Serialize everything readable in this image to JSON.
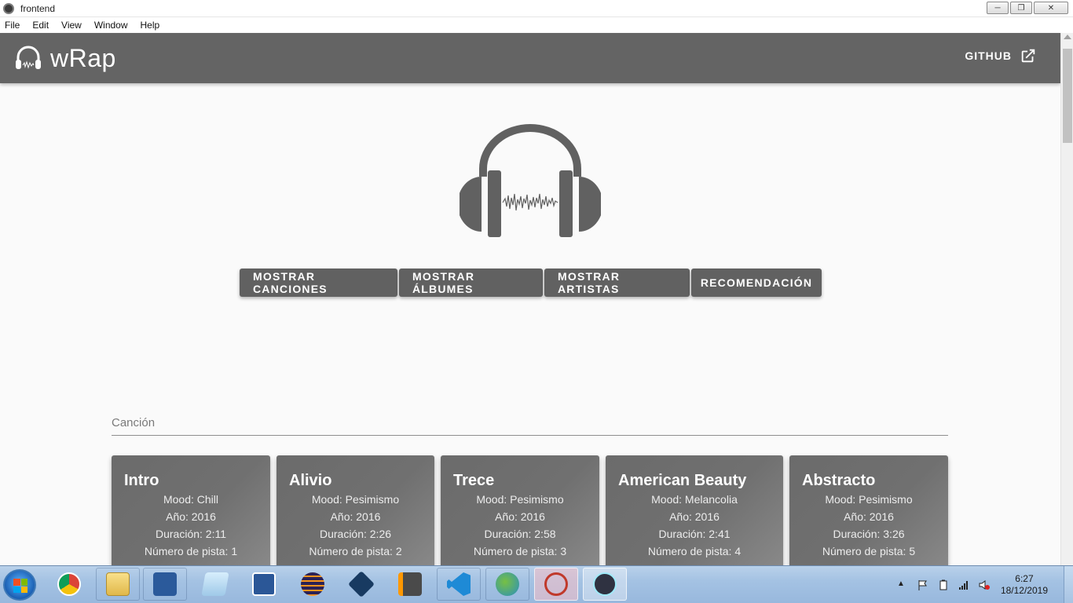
{
  "window": {
    "title": "frontend",
    "controls": [
      "minimize",
      "restore",
      "close"
    ]
  },
  "menu": [
    "File",
    "Edit",
    "View",
    "Window",
    "Help"
  ],
  "appbar": {
    "brand": "wRap",
    "github_label": "GITHUB",
    "logo_icon": "headphones-icon",
    "github_icon": "open-in-new-icon"
  },
  "buttons": [
    {
      "label": "MOSTRAR CANCIONES"
    },
    {
      "label": "MOSTRAR ÁLBUMES"
    },
    {
      "label": "MOSTRAR ARTISTAS"
    },
    {
      "label": "RECOMENDACIÓN"
    }
  ],
  "search": {
    "placeholder": "Canción",
    "value": ""
  },
  "songs": [
    {
      "title": "Intro",
      "mood": "Mood: Chill",
      "year": "Año: 2016",
      "duration": "Duración: 2:11",
      "track": "Número de pista: 1"
    },
    {
      "title": "Alivio",
      "mood": "Mood: Pesimismo",
      "year": "Año: 2016",
      "duration": "Duración: 2:26",
      "track": "Número de pista: 2"
    },
    {
      "title": "Trece",
      "mood": "Mood: Pesimismo",
      "year": "Año: 2016",
      "duration": "Duración: 2:58",
      "track": "Número de pista: 3"
    },
    {
      "title": "American Beauty",
      "mood": "Mood: Melancolia",
      "year": "Año: 2016",
      "duration": "Duración: 2:41",
      "track": "Número de pista: 4"
    },
    {
      "title": "Abstracto",
      "mood": "Mood: Pesimismo",
      "year": "Año: 2016",
      "duration": "Duración: 3:26",
      "track": "Número de pista: 5"
    }
  ],
  "taskbar": {
    "apps": [
      "chrome-icon",
      "file-explorer-icon",
      "powershell-icon",
      "notepad-icon",
      "word-icon",
      "eclipse-icon",
      "virtualbox-icon",
      "sublime-text-icon",
      "vscode-icon",
      "network-map-icon",
      "snipping-tool-icon",
      "electron-icon"
    ],
    "time": "6:27",
    "date": "18/12/2019"
  },
  "colors": {
    "appbar": "#646464",
    "button": "#616161",
    "background": "#fafafa"
  }
}
